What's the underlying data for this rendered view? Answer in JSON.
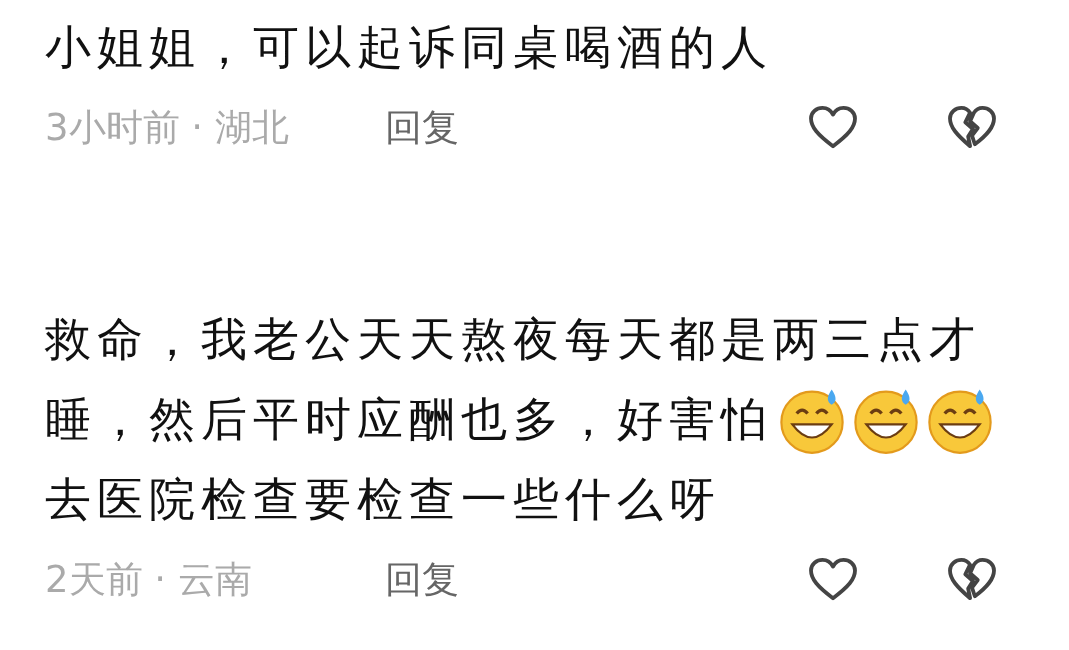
{
  "comments": [
    {
      "lines": [
        {
          "text": "小姐姐，可以起诉同桌喝酒的人"
        }
      ],
      "meta": "3小时前 · 湖北",
      "reply": "回复"
    },
    {
      "lines": [
        {
          "text": "救命，我老公天天熬夜每天都是两三点才"
        },
        {
          "text": "睡，然后平时应酬也多，好害怕",
          "emojis": [
            {
              "kind": "sweat-smile"
            },
            {
              "kind": "sweat-smile"
            },
            {
              "kind": "sweat-smile"
            }
          ]
        },
        {
          "text": "去医院检查要检查一些什么呀"
        }
      ],
      "meta": "2天前 · 云南",
      "reply": "回复"
    }
  ]
}
